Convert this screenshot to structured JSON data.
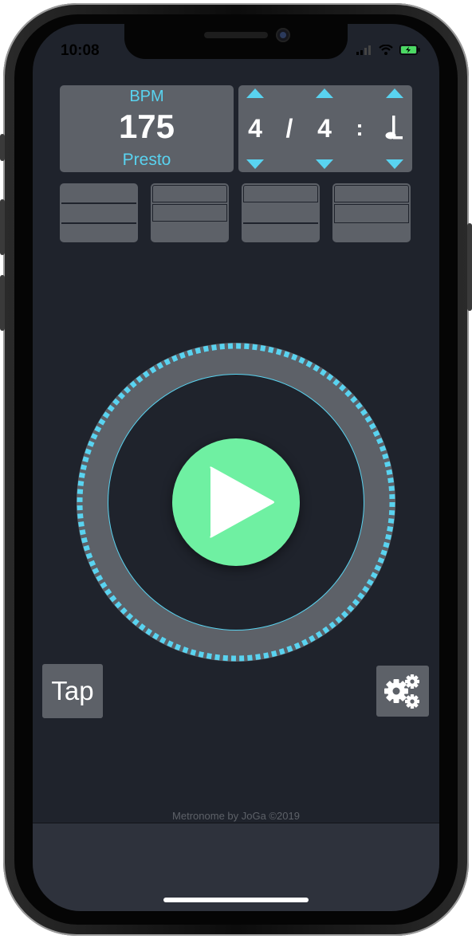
{
  "status_bar": {
    "time": "10:08"
  },
  "bpm_panel": {
    "label": "BPM",
    "value": "175",
    "tempo_name": "Presto"
  },
  "time_signature": {
    "beats": "4",
    "separator": "/",
    "note_value": "4",
    "colon": ":"
  },
  "beats_visualizer": {
    "count": 4
  },
  "controls": {
    "tap_label": "Tap"
  },
  "footer": {
    "credit": "Metronome by JoGa ©2019"
  },
  "colors": {
    "accent": "#59d3f0",
    "play": "#6ff0a2",
    "panel": "#5d6168",
    "background": "#1f232c"
  },
  "icons": [
    "play-icon",
    "gear-icon",
    "note-icon",
    "chevron-up-icon",
    "chevron-down-icon"
  ]
}
